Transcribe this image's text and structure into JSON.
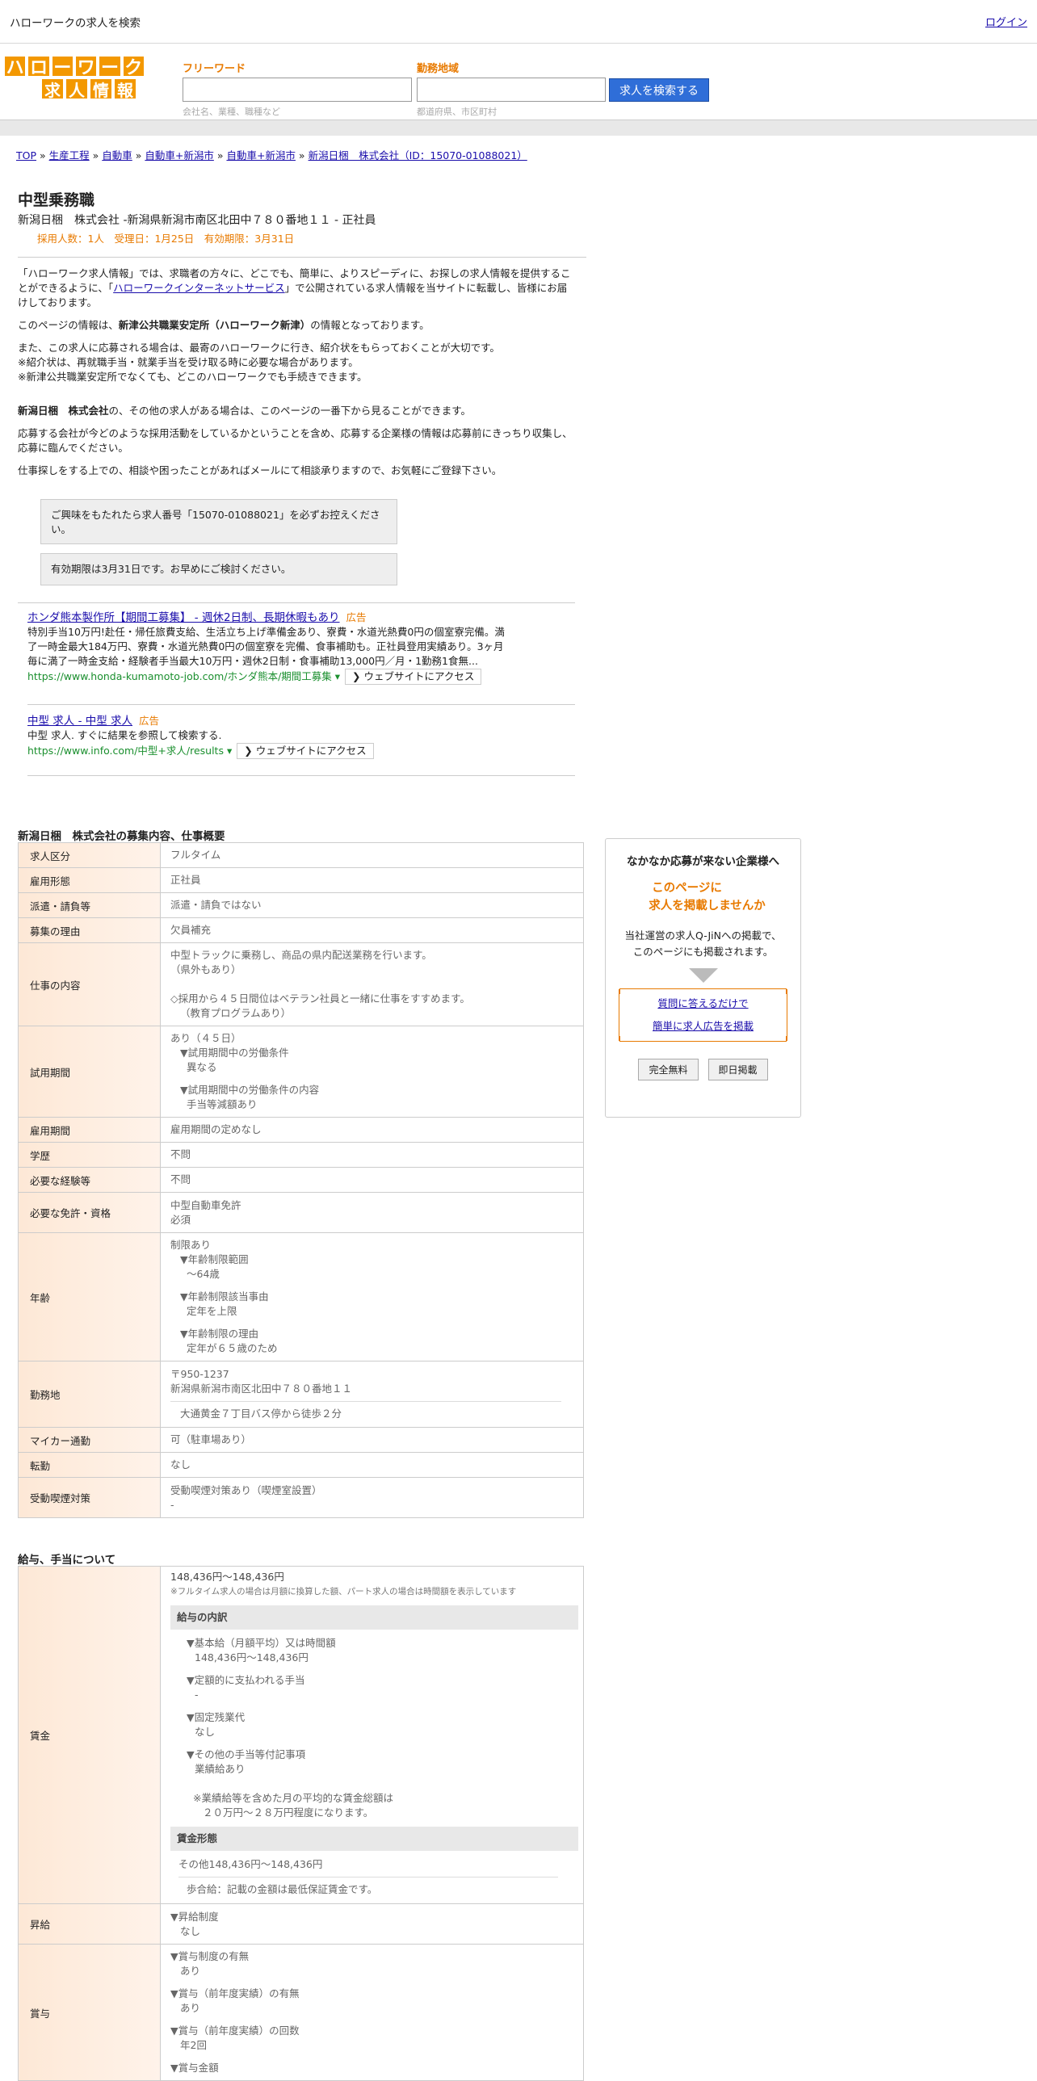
{
  "top": {
    "title": "ハローワークの求人を検索",
    "login": "ログイン"
  },
  "logo": {
    "row1": [
      "ハ",
      "ロ",
      "ー",
      "ワ",
      "ー",
      "ク"
    ],
    "row2": [
      "求",
      "人",
      "情",
      "報"
    ]
  },
  "search": {
    "free_label": "フリーワード",
    "free_placeholder": "会社名、業種、職種など",
    "area_label": "勤務地域",
    "area_placeholder": "都道府県、市区町村",
    "button": "求人を検索する"
  },
  "breadcrumb": [
    "TOP",
    "生産工程",
    "自動車",
    "自動車+新潟市",
    "自動車+新潟市",
    "新潟日梱　株式会社（ID：15070-01088021）"
  ],
  "job": {
    "title": "中型乗務職",
    "company_line": "新潟日梱　株式会社 -新潟県新潟市南区北田中７８０番地１１ - 正社員",
    "meta": "採用人数：1人　受理日：1月25日　有効期限：3月31日"
  },
  "intro": {
    "p1a": "「ハローワーク求人情報」では、求職者の方々に、どこでも、簡単に、よりスピーディに、お探しの求人情報を提供することができるように、「",
    "p1link": "ハローワークインターネットサービス",
    "p1b": "」で公開されている求人情報を当サイトに転載し、皆様にお届けしております。",
    "p2a": "このページの情報は、",
    "p2b": "新津公共職業安定所（ハローワーク新津）",
    "p2c": "の情報となっております。",
    "p3": "また、この求人に応募される場合は、最寄のハローワークに行き、紹介状をもらっておくことが大切です。",
    "p4": "※紹介状は、再就職手当・就業手当を受け取る時に必要な場合があります。",
    "p5": "※新津公共職業安定所でなくても、どこのハローワークでも手続きできます。",
    "p6a": "新潟日梱　株式会社",
    "p6b": "の、その他の求人がある場合は、このページの一番下から見ることができます。",
    "p7": "応募する会社が今どのような採用活動をしているかということを含め、応募する企業様の情報は応募前にきっちり収集し、応募に臨んでください。",
    "p8": "仕事探しをする上での、相談や困ったことがあればメールにて相談承りますので、お気軽にご登録下さい。"
  },
  "notes": [
    "ご興味をもたれたら求人番号「15070-01088021」を必ずお控えください。",
    "有効期限は3月31日です。お早めにご検討ください。"
  ],
  "ads": [
    {
      "title": "ホンダ熊本製作所【期間工募集】 - 週休2日制、長期休暇もあり",
      "badge": "広告",
      "desc": "特別手当10万円!赴任・帰任旅費支給、生活立ち上げ準備金あり、寮費・水道光熱費0円の個室寮完備。満了一時金最大184万円、寮費・水道光熱費0円の個室寮を完備、食事補助も。正社員登用実績あり。3ヶ月毎に満了一時金支給・経験者手当最大10万円・週休2日制・食事補助13,000円／月・1勤務1食無...",
      "url": "https://www.honda-kumamoto-job.com/ホンダ熊本/期間工募集",
      "visit": "ウェブサイトにアクセス"
    },
    {
      "title": "中型 求人 - 中型 求人",
      "badge": "広告",
      "desc": "中型 求人. すぐに結果を参照して検索する.",
      "url": "https://www.info.com/中型+求人/results",
      "visit": "ウェブサイトにアクセス"
    }
  ],
  "section1": {
    "title": "新潟日梱　株式会社の募集内容、仕事概要",
    "rows": [
      {
        "k": "求人区分",
        "v": [
          "フルタイム"
        ]
      },
      {
        "k": "雇用形態",
        "v": [
          "正社員"
        ]
      },
      {
        "k": "派遣・請負等",
        "v": [
          "派遣・請負ではない"
        ]
      },
      {
        "k": "募集の理由",
        "v": [
          "欠員補充"
        ]
      },
      {
        "k": "仕事の内容",
        "v": [
          "中型トラックに乗務し、商品の県内配送業務を行います。",
          "（県外もあり）",
          "",
          "◇採用から４５日間位はベテラン社員と一緒に仕事をすすめます。",
          "（教育プログラムあり）"
        ]
      },
      {
        "k": "試用期間",
        "v": [
          "あり（４５日）",
          "▼試用期間中の労働条件",
          "異なる",
          "",
          "▼試用期間中の労働条件の内容",
          "手当等減額あり"
        ]
      },
      {
        "k": "雇用期間",
        "v": [
          "雇用期間の定めなし"
        ]
      },
      {
        "k": "学歴",
        "v": [
          "不問"
        ]
      },
      {
        "k": "必要な経験等",
        "v": [
          "不問"
        ]
      },
      {
        "k": "必要な免許・資格",
        "v": [
          "中型自動車免許",
          "必須"
        ]
      },
      {
        "k": "年齢",
        "v": [
          "制限あり",
          "▼年齢制限範囲",
          "〜64歳",
          "",
          "▼年齢制限該当事由",
          "定年を上限",
          "",
          "▼年齢制限の理由",
          "定年が６５歳のため"
        ]
      },
      {
        "k": "勤務地",
        "v": [
          "〒950-1237",
          "新潟県新潟市南区北田中７８０番地１１",
          "大通黄金７丁目バス停から徒歩２分"
        ]
      },
      {
        "k": "マイカー通勤",
        "v": [
          "可（駐車場あり）"
        ]
      },
      {
        "k": "転勤",
        "v": [
          "なし"
        ]
      },
      {
        "k": "受動喫煙対策",
        "v": [
          "受動喫煙対策あり（喫煙室設置）",
          "-"
        ]
      }
    ]
  },
  "section2": {
    "title": "給与、手当について",
    "wage_key": "賃金",
    "wage_range": "148,436円〜148,436円",
    "wage_note": "※フルタイム求人の場合は月額に換算した額、パート求人の場合は時間額を表示しています",
    "breakdown_hd": "給与の内訳",
    "breakdown": [
      {
        "h": "▼基本給（月額平均）又は時間額",
        "v": "148,436円〜148,436円"
      },
      {
        "h": "▼定額的に支払われる手当",
        "v": "-"
      },
      {
        "h": "▼固定残業代",
        "v": "なし"
      },
      {
        "h": "▼その他の手当等付記事項",
        "v": "業績給あり"
      }
    ],
    "avg_note1": "※業績給等を含めた月の平均的な賃金総額は",
    "avg_note2": "２０万円～２８万円程度になります。",
    "form_hd": "賃金形態",
    "form_v": "その他148,436円〜148,436円",
    "form_note": "歩合給：記載の金額は最低保証賃金です。",
    "raise_key": "昇給",
    "raise": [
      "▼昇給制度",
      "なし"
    ],
    "bonus_key": "賞与",
    "bonus": [
      {
        "h": "▼賞与制度の有無",
        "v": "あり"
      },
      {
        "h": "▼賞与（前年度実績）の有無",
        "v": "あり"
      },
      {
        "h": "▼賞与（前年度実績）の回数",
        "v": "年2回"
      },
      {
        "h": "▼賞与金額",
        "v": ""
      }
    ]
  },
  "side": {
    "head": "なかなか応募が来ない企業様へ",
    "orange1": "このページに",
    "orange2": "求人を掲載しませんか",
    "desc1": "当社運営の求人Q-JiNへの掲載で、",
    "desc2": "このページにも掲載されます。",
    "link1": "質問に答えるだけで",
    "link2": "簡単に求人広告を掲載",
    "btn1": "完全無料",
    "btn2": "即日掲載"
  }
}
